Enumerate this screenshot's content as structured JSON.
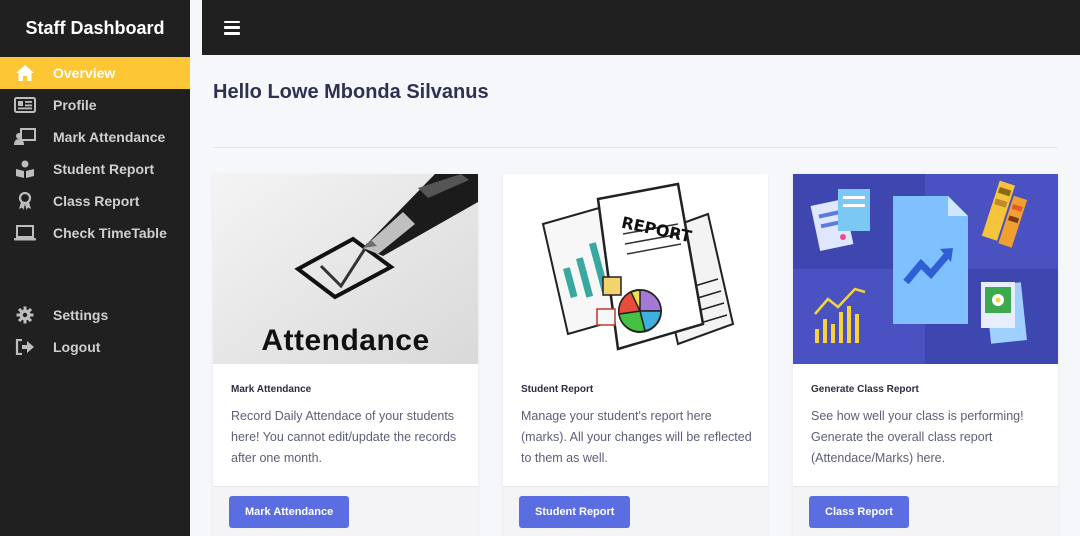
{
  "sidebar": {
    "brand": "Staff Dashboard",
    "items": [
      {
        "label": "Overview",
        "icon": "home-icon",
        "active": true
      },
      {
        "label": "Profile",
        "icon": "id-card-icon"
      },
      {
        "label": "Mark Attendance",
        "icon": "chalkboard-teacher-icon"
      },
      {
        "label": "Student Report",
        "icon": "book-reader-icon"
      },
      {
        "label": "Class Report",
        "icon": "award-icon"
      },
      {
        "label": "Check TimeTable",
        "icon": "laptop-icon"
      }
    ],
    "bottom_items": [
      {
        "label": "Settings",
        "icon": "gear-icon"
      },
      {
        "label": "Logout",
        "icon": "sign-out-icon"
      }
    ]
  },
  "header": {
    "menu_icon": "hamburger-menu-icon"
  },
  "main": {
    "greeting": "Hello Lowe Mbonda Silvanus",
    "cards": [
      {
        "image_label": "Attendance",
        "title": "Mark Attendance",
        "text": "Record Daily Attendace of your students here! You cannot edit/update the records after one month.",
        "button": "Mark Attendance"
      },
      {
        "image_label": "REPORT",
        "title": "Student Report",
        "text": "Manage your student's report here (marks). All your changes will be reflected to them as well.",
        "button": "Student Report"
      },
      {
        "title": "Generate Class Report",
        "text": "See how well your class is performing! Generate the overall class report (Attendace/Marks) here.",
        "button": "Class Report"
      }
    ]
  },
  "colors": {
    "sidebar_bg": "#202020",
    "active_item": "#fcc634",
    "button": "#5b6ee1",
    "heading": "#2d3252"
  }
}
